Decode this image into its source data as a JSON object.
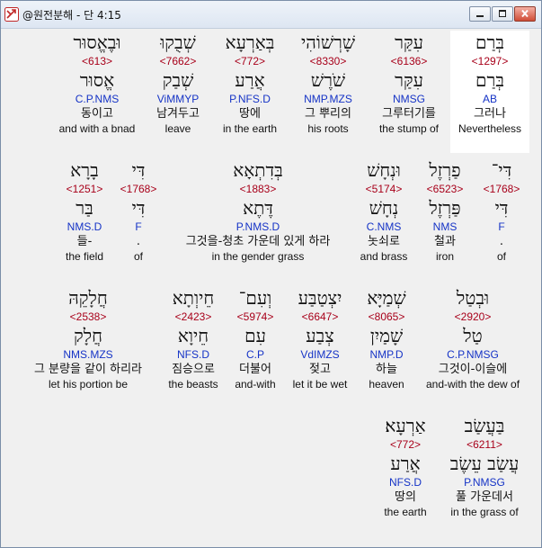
{
  "window": {
    "title": "@원전분해 - 단 4:15"
  },
  "icons": {
    "app": "cross-arrows-icon",
    "minimize": "minimize-icon",
    "maximize": "maximize-icon",
    "close": "close-icon"
  },
  "colors": {
    "strong": "#a8001a",
    "morph": "#1533c6",
    "text": "#111111",
    "highlight": "#ffffff"
  },
  "rows": [
    {
      "words": [
        {
          "hebrew": "בְּרַם",
          "strong": "<1297>",
          "lexeme": "בְּרַם",
          "morph": "AB",
          "korean": "그러나",
          "english": "Nevertheless",
          "highlight": true
        },
        {
          "hebrew": "עִקַּר",
          "strong": "<6136>",
          "lexeme": "עִקַּר",
          "morph": "NMSG",
          "korean": "그루터기를",
          "english": "the stump of"
        },
        {
          "hebrew": "שָׁרְשׁוֹהִי",
          "strong": "<8330>",
          "lexeme": "שֹׁרֶשׁ",
          "morph": "NMP.MZS",
          "korean": "그 뿌리의",
          "english": "his roots"
        },
        {
          "hebrew": "בְּאַרְעָא",
          "strong": "<772>",
          "lexeme": "אֲרַע",
          "morph": "P.NFS.D",
          "korean": "땅에",
          "english": "in the earth"
        },
        {
          "hebrew": "שְׁבֻקוּ",
          "strong": "<7662>",
          "lexeme": "שְׁבַק",
          "morph": "ViMMYP",
          "korean": "남겨두고",
          "english": "leave"
        },
        {
          "hebrew": "וּבֶאֱסוּר",
          "strong": "<613>",
          "lexeme": "אֱסוּר",
          "morph": "C.P.NMS",
          "korean": "동이고",
          "english": "and with a bnad"
        }
      ]
    },
    {
      "words": [
        {
          "hebrew": "דִּי־",
          "strong": "<1768>",
          "lexeme": "דִּי",
          "morph": "F",
          "korean": ".",
          "english": "of"
        },
        {
          "hebrew": "פַרְזֶל",
          "strong": "<6523>",
          "lexeme": "פַּרְזֶל",
          "morph": "NMS",
          "korean": "철과",
          "english": "iron"
        },
        {
          "hebrew": "וּנְחָשׁ",
          "strong": "<5174>",
          "lexeme": "נְחָשׁ",
          "morph": "C.NMS",
          "korean": "놋쇠로",
          "english": "and brass"
        },
        {
          "hebrew": "בְּדִתְאָא",
          "strong": "<1883>",
          "lexeme": "דֶּתֶא",
          "morph": "P.NMS.D",
          "korean": "그것을-청초 가운데 있게 하라",
          "english": "in the gender grass"
        },
        {
          "hebrew": "דִּי",
          "strong": "<1768>",
          "lexeme": "דִּי",
          "morph": "F",
          "korean": ".",
          "english": "of"
        },
        {
          "hebrew": "בָרָא",
          "strong": "<1251>",
          "lexeme": "בַּר",
          "morph": "NMS.D",
          "korean": "들-",
          "english": "the field"
        }
      ]
    },
    {
      "words": [
        {
          "hebrew": "וּבְטַל",
          "strong": "<2920>",
          "lexeme": "טַל",
          "morph": "C.P.NMSG",
          "korean": "그것이-이슬에",
          "english": "and-with the dew of"
        },
        {
          "hebrew": "שְׁמַיָּא",
          "strong": "<8065>",
          "lexeme": "שָׁמַיִן",
          "morph": "NMP.D",
          "korean": "하늘",
          "english": "heaven"
        },
        {
          "hebrew": "יִצְטַבַּע",
          "strong": "<6647>",
          "lexeme": "צְבַע",
          "morph": "VdIMZS",
          "korean": "젖고",
          "english": "let it be wet"
        },
        {
          "hebrew": "וְעִם־",
          "strong": "<5974>",
          "lexeme": "עִם",
          "morph": "C.P",
          "korean": "더불어",
          "english": "and-with"
        },
        {
          "hebrew": "חֵיוְתָא",
          "strong": "<2423>",
          "lexeme": "חֵיוָא",
          "morph": "NFS.D",
          "korean": "짐승으로",
          "english": "the beasts"
        },
        {
          "hebrew": "חֲלָקֵהּ",
          "strong": "<2538>",
          "lexeme": "חֲלָק",
          "morph": "NMS.MZS",
          "korean": "그 분량을 같이 하리라",
          "english": "let his portion be"
        }
      ]
    },
    {
      "words": [
        {
          "hebrew": "בַּעֲשַׂב",
          "strong": "<6211>",
          "lexeme": "עֲשַׂב עֵשֶׂב",
          "morph": "P.NMSG",
          "korean": "풀 가운데서",
          "english": "in the grass of"
        },
        {
          "hebrew": "אַרְעָא׃",
          "strong": "<772>",
          "lexeme": "אֲרַע",
          "morph": "NFS.D",
          "korean": "땅의",
          "english": "the earth"
        }
      ]
    }
  ]
}
